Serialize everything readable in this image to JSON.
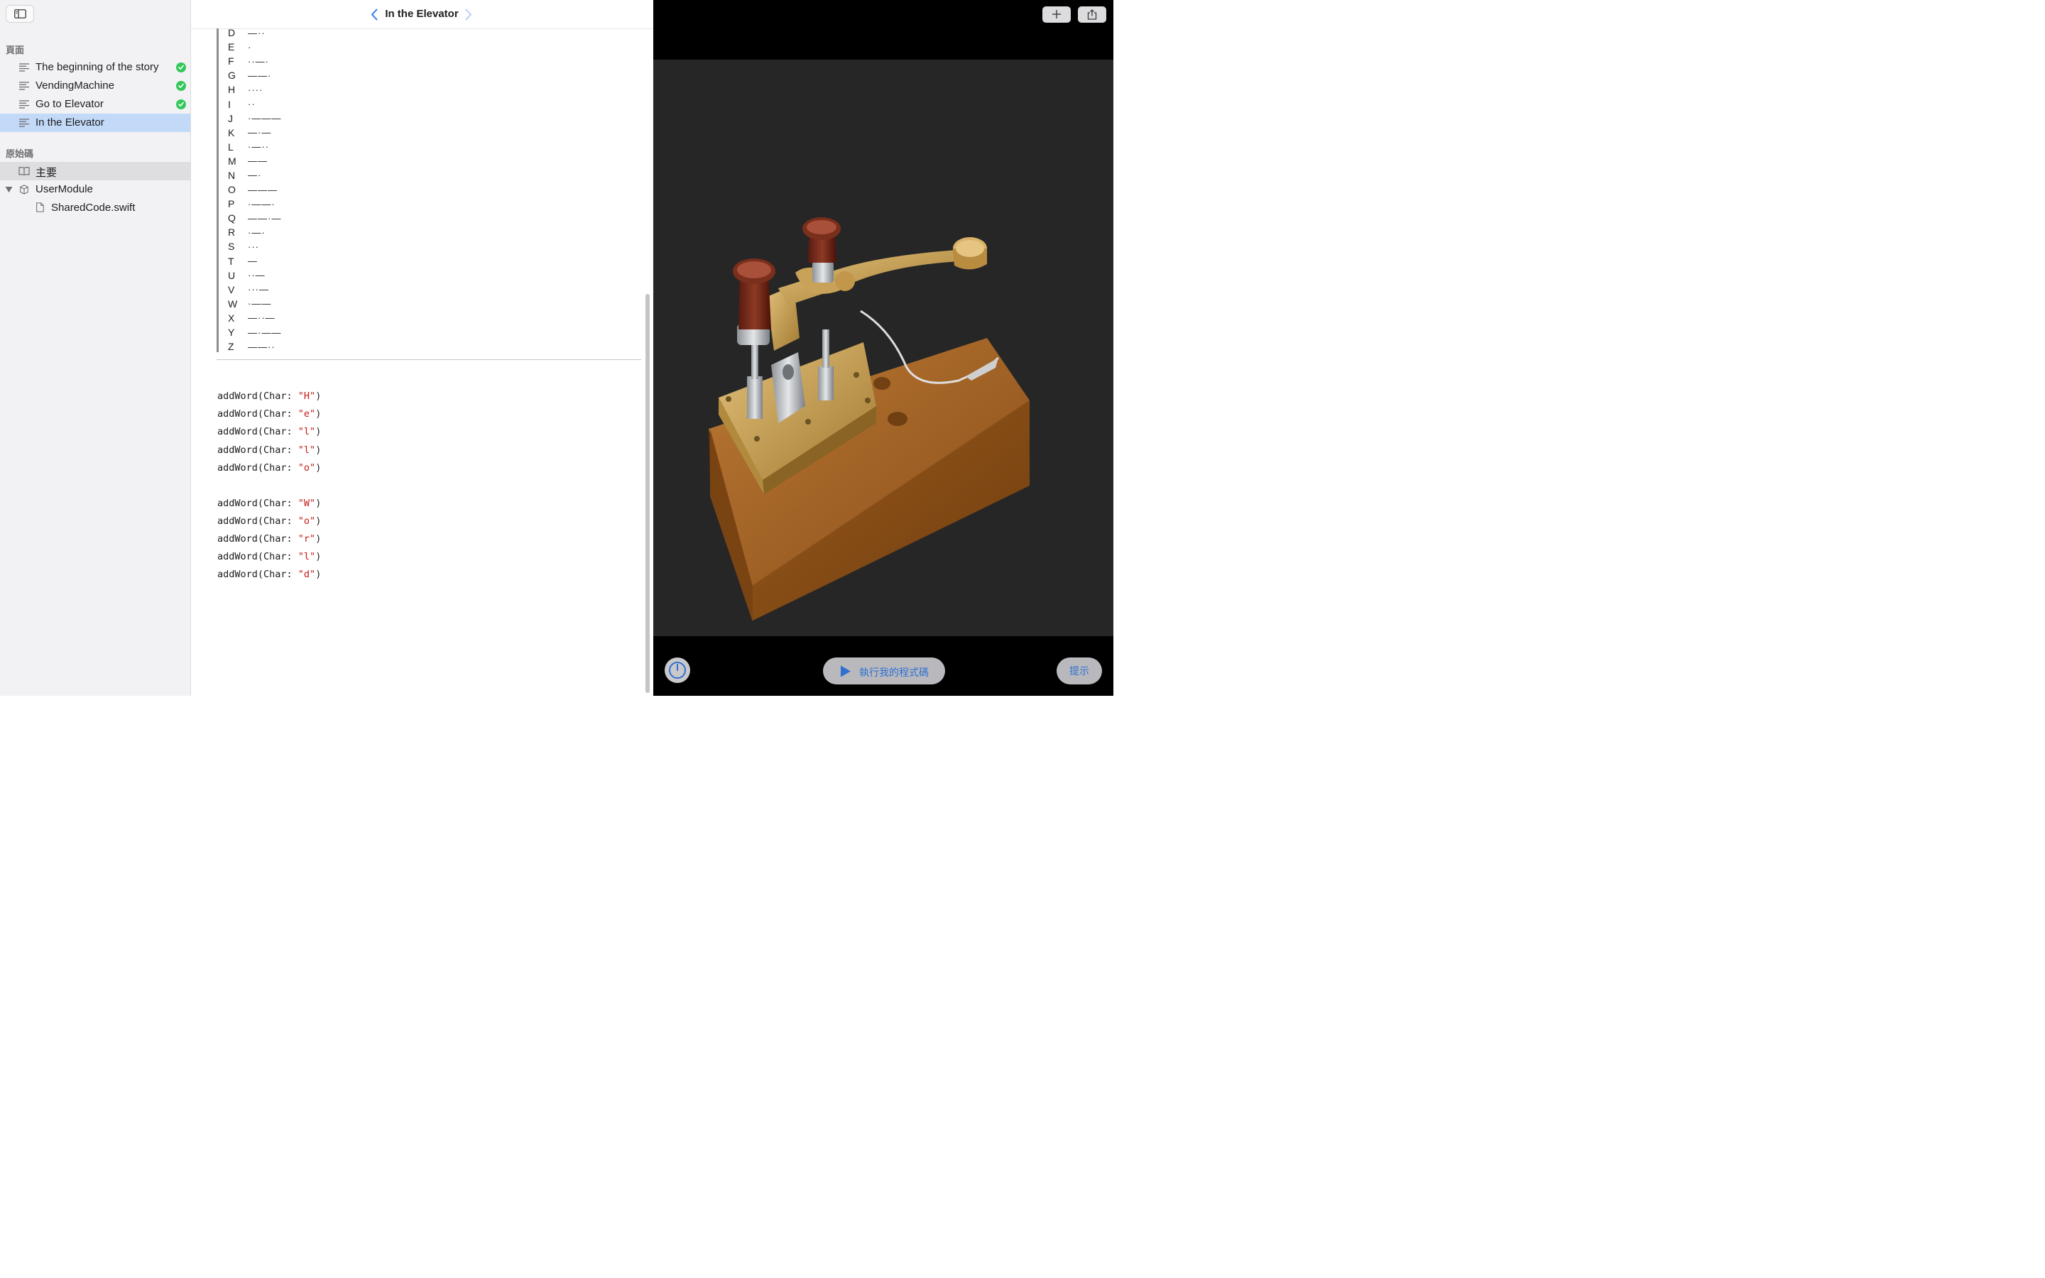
{
  "sidebar": {
    "pages_header": "頁面",
    "pages": [
      {
        "label": "The beginning of the story",
        "completed": true
      },
      {
        "label": "VendingMachine",
        "completed": true
      },
      {
        "label": "Go to Elevator",
        "completed": true
      },
      {
        "label": "In the Elevator",
        "completed": false,
        "selected": true
      }
    ],
    "source_header": "原始碼",
    "source_items": [
      {
        "label": "主要",
        "icon": "book-icon"
      },
      {
        "label": "UserModule",
        "icon": "module-cube-icon"
      },
      {
        "label": "SharedCode.swift",
        "icon": "file-icon"
      }
    ]
  },
  "editor": {
    "title": "In the Elevator",
    "morse_table": [
      {
        "letter": "D",
        "code": "—··"
      },
      {
        "letter": "E",
        "code": "·"
      },
      {
        "letter": "F",
        "code": "··—·"
      },
      {
        "letter": "G",
        "code": "——·"
      },
      {
        "letter": "H",
        "code": "····"
      },
      {
        "letter": "I",
        "code": "··"
      },
      {
        "letter": "J",
        "code": "·———"
      },
      {
        "letter": "K",
        "code": "—·—"
      },
      {
        "letter": "L",
        "code": "·—··"
      },
      {
        "letter": "M",
        "code": "——"
      },
      {
        "letter": "N",
        "code": "—·"
      },
      {
        "letter": "O",
        "code": "———"
      },
      {
        "letter": "P",
        "code": "·——·"
      },
      {
        "letter": "Q",
        "code": "——·—"
      },
      {
        "letter": "R",
        "code": "·—·"
      },
      {
        "letter": "S",
        "code": "···"
      },
      {
        "letter": "T",
        "code": "—"
      },
      {
        "letter": "U",
        "code": "··—"
      },
      {
        "letter": "V",
        "code": "···—"
      },
      {
        "letter": "W",
        "code": "·——"
      },
      {
        "letter": "X",
        "code": "—··—"
      },
      {
        "letter": "Y",
        "code": "—·——"
      },
      {
        "letter": "Z",
        "code": "——··"
      }
    ],
    "code_func": "addWord(Char: ",
    "code_close": ")",
    "code_groups": [
      [
        "\"H\"",
        "\"e\"",
        "\"l\"",
        "\"l\"",
        "\"o\""
      ],
      [
        "\"W\"",
        "\"o\"",
        "\"r\"",
        "\"l\"",
        "\"d\""
      ]
    ]
  },
  "liveview": {
    "top_buttons": [
      {
        "name": "add-button",
        "icon": "plus-icon"
      },
      {
        "name": "share-button",
        "icon": "share-icon"
      }
    ],
    "run_label": "執行我的程式碼",
    "hint_label": "提示",
    "image_subject": "telegraph-key"
  },
  "colors": {
    "selection": "#c2d9f7",
    "check_green": "#34c759",
    "string_red": "#c41a16",
    "accent_blue": "#2f6fd1"
  }
}
